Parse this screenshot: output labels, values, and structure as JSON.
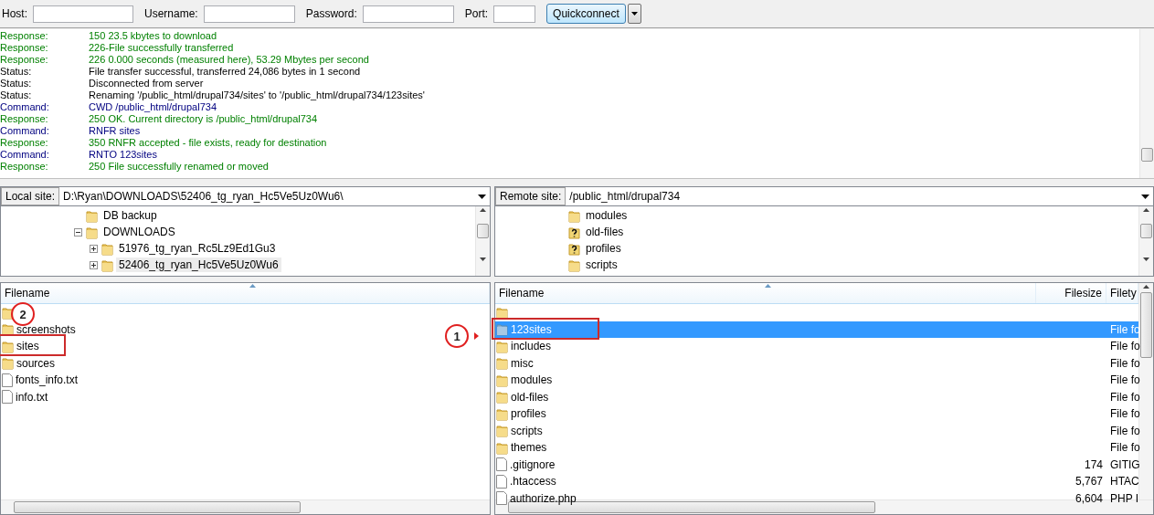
{
  "toolbar": {
    "fields": [
      {
        "label": "Host:"
      },
      {
        "label": "Username:"
      },
      {
        "label": "Password:"
      },
      {
        "label": "Port:"
      }
    ],
    "button": "Quickconnect"
  },
  "log": [
    {
      "kind": "response",
      "label": "Response:",
      "message": "150 23.5 kbytes to download"
    },
    {
      "kind": "response",
      "label": "Response:",
      "message": "226-File successfully transferred"
    },
    {
      "kind": "response",
      "label": "Response:",
      "message": "226 0.000 seconds (measured here), 53.29 Mbytes per second"
    },
    {
      "kind": "status",
      "label": "Status:",
      "message": "File transfer successful, transferred 24,086 bytes in 1 second"
    },
    {
      "kind": "status",
      "label": "Status:",
      "message": "Disconnected from server"
    },
    {
      "kind": "status",
      "label": "Status:",
      "message": "Renaming '/public_html/drupal734/sites' to '/public_html/drupal734/123sites'"
    },
    {
      "kind": "command",
      "label": "Command:",
      "message": "CWD /public_html/drupal734"
    },
    {
      "kind": "response",
      "label": "Response:",
      "message": "250 OK. Current directory is /public_html/drupal734"
    },
    {
      "kind": "command",
      "label": "Command:",
      "message": "RNFR sites"
    },
    {
      "kind": "response",
      "label": "Response:",
      "message": "350 RNFR accepted - file exists, ready for destination"
    },
    {
      "kind": "command",
      "label": "Command:",
      "message": "RNTO 123sites"
    },
    {
      "kind": "response",
      "label": "Response:",
      "message": "250 File successfully renamed or moved"
    }
  ],
  "local": {
    "site_label": "Local site:",
    "path": "D:\\Ryan\\DOWNLOADS\\52406_tg_ryan_Hc5Ve5Uz0Wu6\\",
    "tree": [
      {
        "label": "DB backup",
        "kind": "folder",
        "selected": false
      },
      {
        "label": "DOWNLOADS",
        "kind": "folder",
        "expanded": true,
        "selected": false,
        "children": [
          {
            "label": "51976_tg_ryan_Rc5Lz9Ed1Gu3",
            "kind": "folder",
            "expanded": false,
            "selected": false
          },
          {
            "label": "52406_tg_ryan_Hc5Ve5Uz0Wu6",
            "kind": "folder",
            "expanded": false,
            "selected": true
          }
        ]
      }
    ],
    "columns": [
      "Filename"
    ],
    "callout": "2",
    "files": [
      {
        "kind": "folder",
        "selected": false,
        "highlighted": false
      },
      {
        "kind": "folder",
        "name": "screenshots",
        "selected": false,
        "highlighted": false
      },
      {
        "kind": "folder",
        "name": "sites",
        "selected": false,
        "highlighted": true
      },
      {
        "kind": "folder",
        "name": "sources",
        "selected": false,
        "highlighted": false
      },
      {
        "kind": "file",
        "name": "fonts_info.txt",
        "selected": false,
        "highlighted": false
      },
      {
        "kind": "file",
        "name": "info.txt",
        "selected": false,
        "highlighted": false
      }
    ]
  },
  "remote": {
    "site_label": "Remote site:",
    "path": "/public_html/drupal734",
    "tree": [
      {
        "label": "modules",
        "kind": "folder",
        "selected": false
      },
      {
        "label": "old-files",
        "kind": "unknown",
        "selected": false
      },
      {
        "label": "profiles",
        "kind": "unknown",
        "selected": false
      },
      {
        "label": "scripts",
        "kind": "folder",
        "selected": false
      }
    ],
    "columns": [
      "Filename",
      "Filesize",
      "Filety"
    ],
    "callout": "1",
    "files": [
      {
        "kind": "folder",
        "selected": false,
        "highlighted": false
      },
      {
        "kind": "folder",
        "name": "123sites",
        "type": "File fo",
        "selected": true,
        "highlighted": true
      },
      {
        "kind": "folder",
        "name": "includes",
        "type": "File fo",
        "selected": false,
        "highlighted": false
      },
      {
        "kind": "folder",
        "name": "misc",
        "type": "File fo",
        "selected": false,
        "highlighted": false
      },
      {
        "kind": "folder",
        "name": "modules",
        "type": "File fo",
        "selected": false,
        "highlighted": false
      },
      {
        "kind": "folder",
        "name": "old-files",
        "type": "File fo",
        "selected": false,
        "highlighted": false
      },
      {
        "kind": "folder",
        "name": "profiles",
        "type": "File fo",
        "selected": false,
        "highlighted": false
      },
      {
        "kind": "folder",
        "name": "scripts",
        "type": "File fo",
        "selected": false,
        "highlighted": false
      },
      {
        "kind": "folder",
        "name": "themes",
        "type": "File fo",
        "selected": false,
        "highlighted": false
      },
      {
        "kind": "file",
        "name": ".gitignore",
        "size": "174",
        "type": "GITIG",
        "selected": false,
        "highlighted": false
      },
      {
        "kind": "file",
        "name": ".htaccess",
        "size": "5,767",
        "type": "HTAC",
        "selected": false,
        "highlighted": false
      },
      {
        "kind": "file",
        "name": "authorize.php",
        "size": "6,604",
        "type": "PHP I",
        "selected": false,
        "highlighted": false
      }
    ]
  }
}
